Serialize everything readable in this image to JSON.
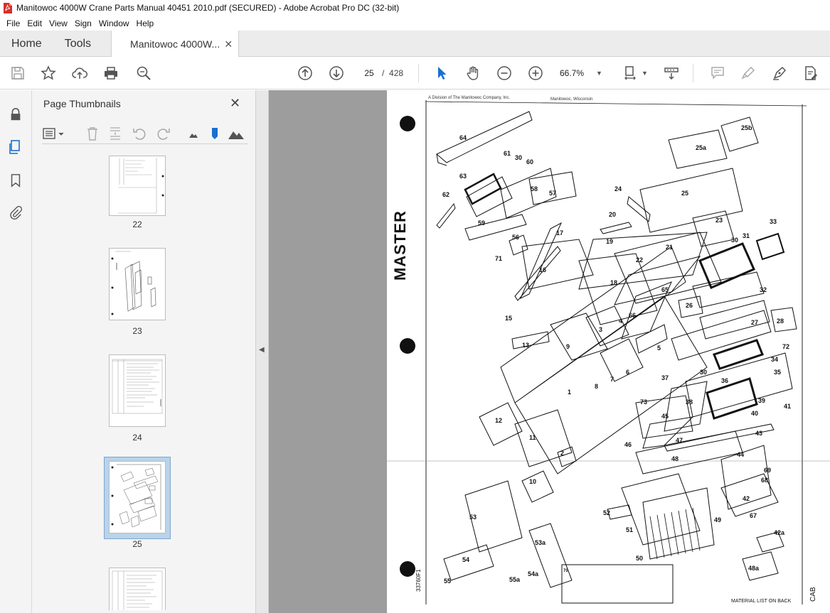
{
  "window": {
    "title": "Manitowoc 4000W Crane Parts Manual 40451 2010.pdf (SECURED) - Adobe Acrobat Pro DC (32-bit)"
  },
  "menu": [
    "File",
    "Edit",
    "View",
    "Sign",
    "Window",
    "Help"
  ],
  "tabs": {
    "home": "Home",
    "tools": "Tools",
    "document": "Manitowoc 4000W..."
  },
  "toolbar": {
    "current_page": "25",
    "page_separator": "/",
    "total_pages": "428",
    "zoom": "66.7%"
  },
  "panel": {
    "title": "Page Thumbnails",
    "thumbnails": [
      {
        "label": "22"
      },
      {
        "label": "23"
      },
      {
        "label": "24"
      },
      {
        "label": "25",
        "selected": true
      },
      {
        "label": ""
      }
    ]
  },
  "document_page": {
    "header_left": "A Division of The Manitowoc Company, Inc.",
    "header_right": "Manitowoc, Wisconsin",
    "stamp": "MASTER",
    "drawing_number": "33760F1",
    "footer": "MATERIAL LIST ON BACK",
    "section": "CAB",
    "callouts": [
      "64",
      "61",
      "30",
      "60",
      "63",
      "58",
      "57",
      "62",
      "59",
      "56",
      "17",
      "71",
      "16",
      "15",
      "13",
      "20",
      "19",
      "18",
      "24",
      "25",
      "25a",
      "25b",
      "21",
      "22",
      "23",
      "33",
      "31",
      "30",
      "32",
      "65",
      "66",
      "26",
      "3",
      "4",
      "9",
      "8",
      "7",
      "6",
      "5",
      "27",
      "28",
      "72",
      "34",
      "35",
      "36",
      "30",
      "37",
      "38",
      "39",
      "40",
      "41",
      "73",
      "45",
      "46",
      "47",
      "1",
      "12",
      "11",
      "2",
      "10",
      "43",
      "44",
      "48",
      "69",
      "68",
      "42",
      "67",
      "49",
      "51",
      "50",
      "52",
      "53",
      "54",
      "55",
      "55a",
      "54a",
      "53a",
      "70",
      "42a",
      "48a"
    ],
    "colors": {
      "background": "#ffffff",
      "ink": "#111111"
    }
  }
}
